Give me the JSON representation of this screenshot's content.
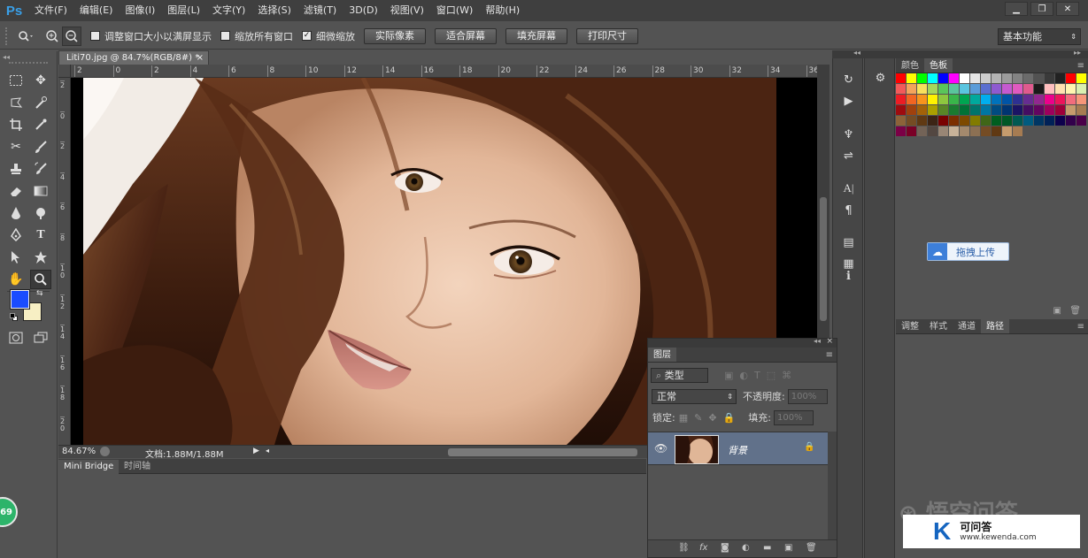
{
  "app": {
    "logo": "Ps"
  },
  "menu": [
    "文件(F)",
    "编辑(E)",
    "图像(I)",
    "图层(L)",
    "文字(Y)",
    "选择(S)",
    "滤镜(T)",
    "3D(D)",
    "视图(V)",
    "窗口(W)",
    "帮助(H)"
  ],
  "window_buttons": {
    "minimize": "▁",
    "restore": "❐",
    "close": "✕"
  },
  "options": {
    "resize_windows": "调整窗口大小以满屏显示",
    "zoom_all": "缩放所有窗口",
    "scrubby_zoom": "细微缩放",
    "scrubby_checked": true,
    "actual_pixels": "实际像素",
    "fit_screen": "适合屏幕",
    "fill_screen": "填充屏幕",
    "print_size": "打印尺寸"
  },
  "workspace": "基本功能",
  "document": {
    "tab": "Liti70.jpg @ 84.7%(RGB/8#) *",
    "tab_close": "×",
    "ruler_h_ticks": [
      "2",
      "0",
      "2",
      "4",
      "6",
      "8",
      "10",
      "12",
      "14",
      "16",
      "18",
      "20",
      "22",
      "24",
      "26",
      "28",
      "30",
      "32",
      "34",
      "36"
    ],
    "ruler_v_ticks": [
      "2",
      "0",
      "2",
      "4",
      "6",
      "8",
      "1\n0",
      "1\n2",
      "1\n4",
      "1\n6",
      "1\n8",
      "2\n0"
    ],
    "zoom": "84.67%",
    "doc_info": "文档:1.88M/1.88M"
  },
  "bottom_tabs": [
    "Mini Bridge",
    "时间轴"
  ],
  "right_panel": {
    "tabs": [
      "颜色",
      "色板"
    ],
    "active_tab": "色板",
    "upload_label": "拖拽上传"
  },
  "adj_panel": {
    "tabs": [
      "调整",
      "样式",
      "通道",
      "路径"
    ],
    "active": "路径"
  },
  "layers": {
    "tab": "图层",
    "filter_kind": "类型",
    "blend_mode": "正常",
    "opacity_label": "不透明度:",
    "opacity_value": "100%",
    "lock_label": "锁定:",
    "fill_label": "填充:",
    "fill_value": "100%",
    "layer_name": "背景"
  },
  "watermark": {
    "brand": "可问答",
    "url": "www.kewenda.com",
    "k": "K",
    "badge": "69"
  },
  "swatch_colors": [
    [
      "#ff0000",
      "#ffff00",
      "#00ff00",
      "#00ffff",
      "#0000ff",
      "#ff00ff",
      "#ffffff",
      "#e6e6e6",
      "#cdcdcd",
      "#b4b4b4",
      "#9c9c9c",
      "#838383",
      "#6b6b6b",
      "#525252",
      "#3a3a3a",
      "#222222",
      "#ff0000",
      "#ffff00"
    ],
    [
      "#f25a5a",
      "#f4a45c",
      "#f8e05c",
      "#a6d75a",
      "#5ac55a",
      "#5ac59c",
      "#5ac5e0",
      "#5a9cd9",
      "#5a6fd0",
      "#8e5ad0",
      "#c55ad0",
      "#e05ac0",
      "#e05a8e",
      "#1a1a1a",
      "#ffbfbf",
      "#ffe0b0",
      "#fff5b0",
      "#d9f0b0"
    ],
    [
      "#ed1c24",
      "#f26522",
      "#f7941d",
      "#fff200",
      "#8dc63f",
      "#39b54a",
      "#00a651",
      "#00a99d",
      "#00aeef",
      "#0072bc",
      "#0054a6",
      "#2e3192",
      "#662d91",
      "#92278f",
      "#ec008c",
      "#ed145b",
      "#f26d7d",
      "#f69679"
    ],
    [
      "#9e0b0f",
      "#a0410d",
      "#a36209",
      "#aba000",
      "#598527",
      "#1a7b30",
      "#007236",
      "#00746b",
      "#0076a3",
      "#004b80",
      "#003471",
      "#1b1464",
      "#440e62",
      "#630460",
      "#9e005d",
      "#9e0039",
      "#c69c6d",
      "#a67c52"
    ],
    [
      "#8c6239",
      "#754c24",
      "#603913",
      "#3c2415",
      "#790000",
      "#7b2e00",
      "#7d4900",
      "#827b00",
      "#406618",
      "#005e20",
      "#005826",
      "#005952",
      "#005b7f",
      "#003663",
      "#002157",
      "#0d004c",
      "#32004b",
      "#4b0049"
    ],
    [
      "#7b0046",
      "#7a0026",
      "#736357",
      "#534741",
      "#998675",
      "#c7b299",
      "#a3896d",
      "#8c7053",
      "#754c24",
      "#603913",
      "#c69c6d",
      "#a67c52"
    ]
  ]
}
